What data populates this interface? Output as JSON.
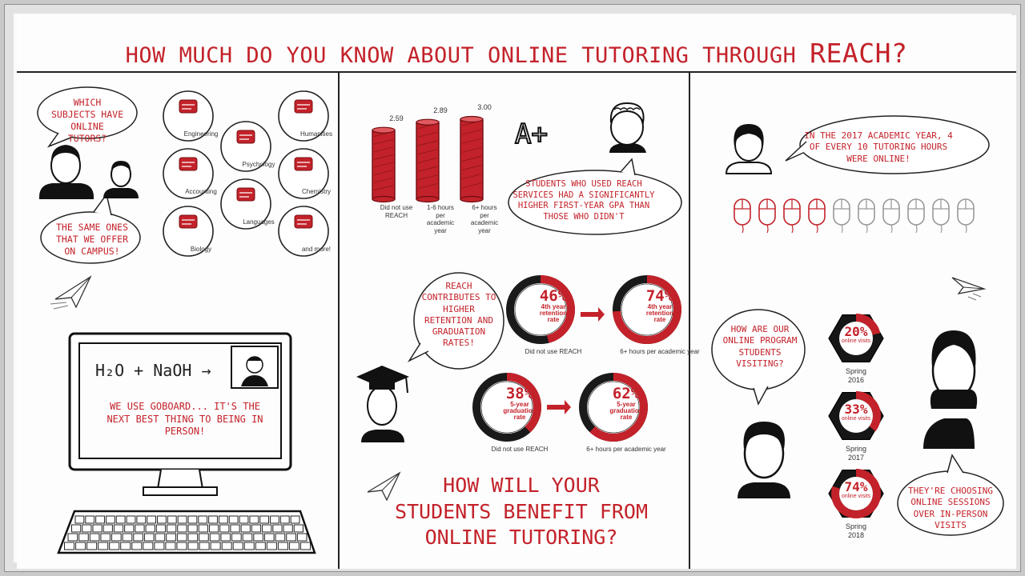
{
  "title": {
    "main": "HOW MUCH DO YOU KNOW ABOUT ONLINE TUTORING THROUGH",
    "brand": "REACH?"
  },
  "left": {
    "q_bubble": "WHICH SUBJECTS HAVE ONLINE TUTORS?",
    "a_bubble": "THE SAME ONES THAT WE OFFER ON CAMPUS!",
    "subjects": [
      "Engineering",
      "Psychology",
      "Humanities",
      "Accounting",
      "Chemistry",
      "Languages",
      "Biology",
      "and more!"
    ],
    "formula": "H₂O + NaOH →",
    "goboard": "WE USE GOBOARD... IT'S THE NEXT BEST THING TO BEING IN PERSON!"
  },
  "middle": {
    "bars": [
      {
        "value_label": "2.59",
        "value": 2.59,
        "label": "Did not use REACH"
      },
      {
        "value_label": "2.89",
        "value": 2.89,
        "label": "1-6 hours per academic year"
      },
      {
        "value_label": "3.00",
        "value": 3.0,
        "label": "6+ hours per academic year"
      }
    ],
    "grade": "A+",
    "gpa_bubble": "STUDENTS WHO USED REACH SERVICES HAD A SIGNIFICANTLY HIGHER FIRST-YEAR GPA THAN THOSE WHO DIDN'T",
    "contrib_bubble": "REACH CONTRIBUTES TO HIGHER RETENTION AND GRADUATION RATES!",
    "retention": [
      {
        "pct": "46%",
        "value": 0.46,
        "line1": "4th year",
        "line2": "retention",
        "line3": "rate",
        "label": "Did not use REACH"
      },
      {
        "pct": "74%",
        "value": 0.74,
        "line1": "4th year",
        "line2": "retention",
        "line3": "rate",
        "label": "6+ hours per academic year"
      }
    ],
    "graduation": [
      {
        "pct": "38%",
        "value": 0.38,
        "line1": "5-year",
        "line2": "graduation",
        "line3": "rate",
        "label": "Did not use REACH"
      },
      {
        "pct": "62%",
        "value": 0.62,
        "line1": "5-year",
        "line2": "graduation",
        "line3": "rate",
        "label": "6+ hours per academic year"
      }
    ],
    "headline": [
      "HOW WILL YOUR",
      "STUDENTS BENEFIT FROM",
      "ONLINE TUTORING?"
    ]
  },
  "right": {
    "online_bubble": "IN THE 2017 ACADEMIC YEAR, 4 OF EVERY 10 TUTORING HOURS WERE ONLINE!",
    "mice_total": 10,
    "mice_online": 4,
    "visit_bubble": "HOW ARE OUR ONLINE PROGRAM STUDENTS VISITING?",
    "hexes": [
      {
        "pct": "20%",
        "value": 0.2,
        "sub": "online visits",
        "label": "Spring 2016"
      },
      {
        "pct": "33%",
        "value": 0.33,
        "sub": "online visits",
        "label": "Spring 2017"
      },
      {
        "pct": "74%",
        "value": 0.74,
        "sub": "online visits",
        "label": "Spring 2018"
      }
    ],
    "choose_bubble": "THEY'RE CHOOSING ONLINE SESSIONS OVER IN-PERSON VISITS"
  },
  "colors": {
    "accent": "#c3222a",
    "ink": "#222222"
  }
}
